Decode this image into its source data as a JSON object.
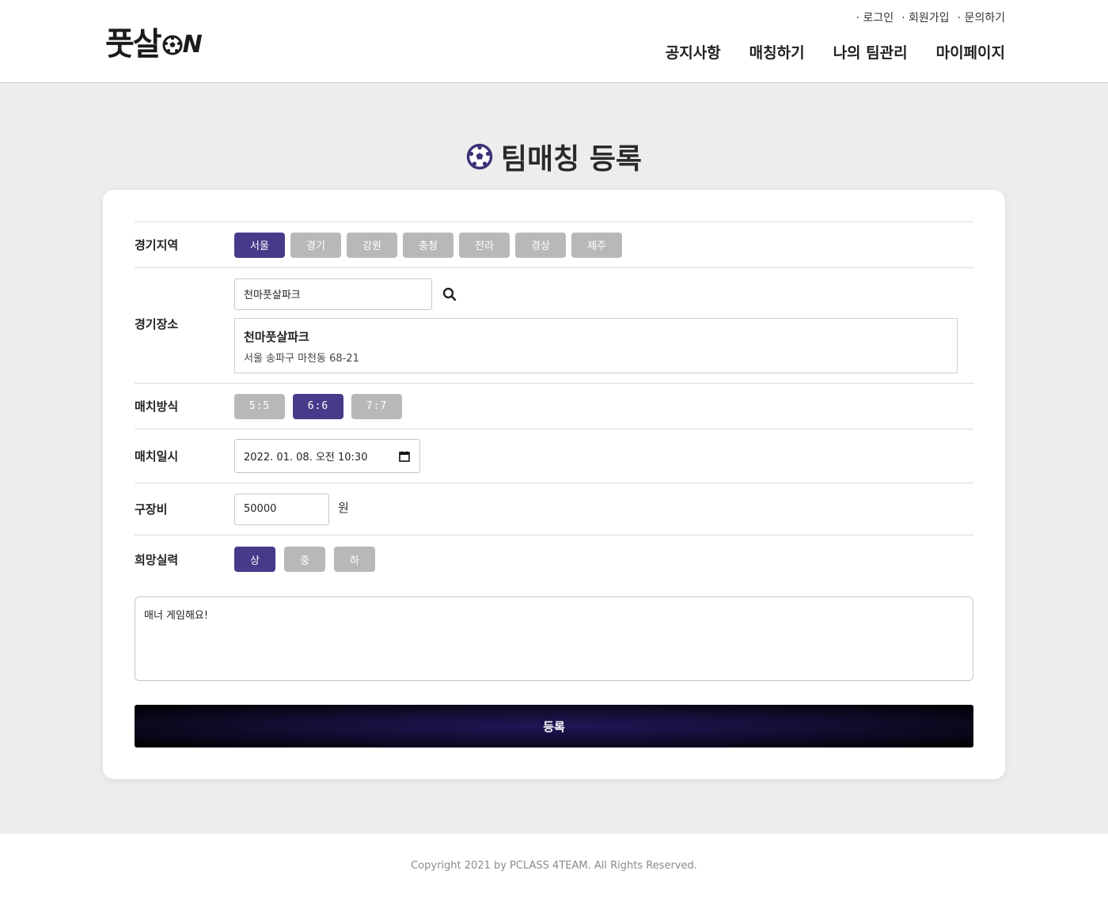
{
  "header": {
    "logo_text": "풋살",
    "logo_suffix": "N",
    "top_links": [
      "로그인",
      "회원가입",
      "문의하기"
    ],
    "nav": [
      "공지사항",
      "매칭하기",
      "나의 팀관리",
      "마이페이지"
    ]
  },
  "page": {
    "title": "팀매칭 등록"
  },
  "form": {
    "region": {
      "label": "경기지역",
      "options": [
        "서울",
        "경기",
        "강원",
        "충청",
        "전라",
        "경상",
        "제주"
      ],
      "selected": "서울"
    },
    "venue": {
      "label": "경기장소",
      "search_value": "천마풋살파크",
      "result_name": "천마풋살파크",
      "result_address": "서울 송파구 마천동 68-21"
    },
    "match_type": {
      "label": "매치방식",
      "options": [
        "5:5",
        "6:6",
        "7:7"
      ],
      "selected": "6:6"
    },
    "datetime": {
      "label": "매치일시",
      "value": "2022. 01. 08. 오전 10:30"
    },
    "fee": {
      "label": "구장비",
      "value": "50000",
      "unit": "원"
    },
    "level": {
      "label": "희망실력",
      "options": [
        "상",
        "중",
        "하"
      ],
      "selected": "상"
    },
    "memo": "매너 게임해요!",
    "submit_label": "등록"
  },
  "footer": {
    "copyright": "Copyright 2021 by PCLASS 4TEAM. All Rights Reserved."
  },
  "colors": {
    "accent": "#463b8a",
    "chip_inactive": "#b8b8b8",
    "background": "#ededed"
  }
}
